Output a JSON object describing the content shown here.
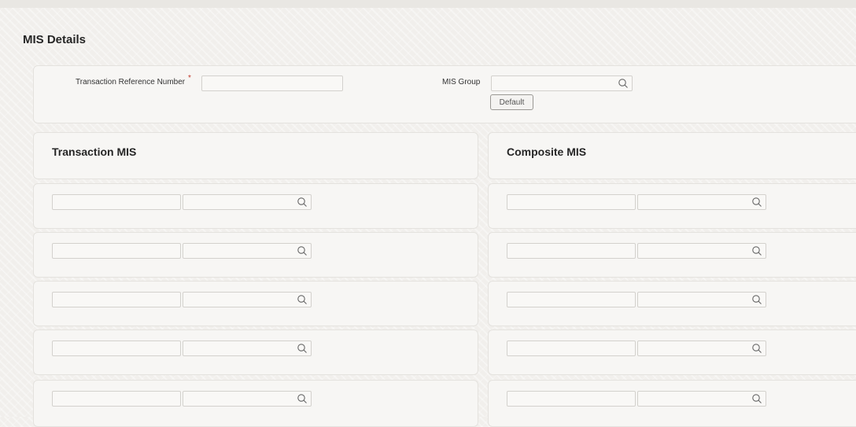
{
  "page": {
    "title": "MIS Details"
  },
  "header_form": {
    "txn_ref_label": "Transaction Reference Number",
    "txn_ref_required": "*",
    "txn_ref_value": "",
    "mis_group_label": "MIS Group",
    "mis_group_value": "",
    "default_button": "Default"
  },
  "sections": {
    "transaction_mis": {
      "title": "Transaction MIS",
      "rows": 5
    },
    "composite_mis": {
      "title": "Composite MIS",
      "rows": 5
    }
  },
  "icons": {
    "lookup": "search-icon"
  },
  "colors": {
    "required": "#c0392b",
    "background": "#f1efec",
    "panel": "#f7f6f4"
  }
}
